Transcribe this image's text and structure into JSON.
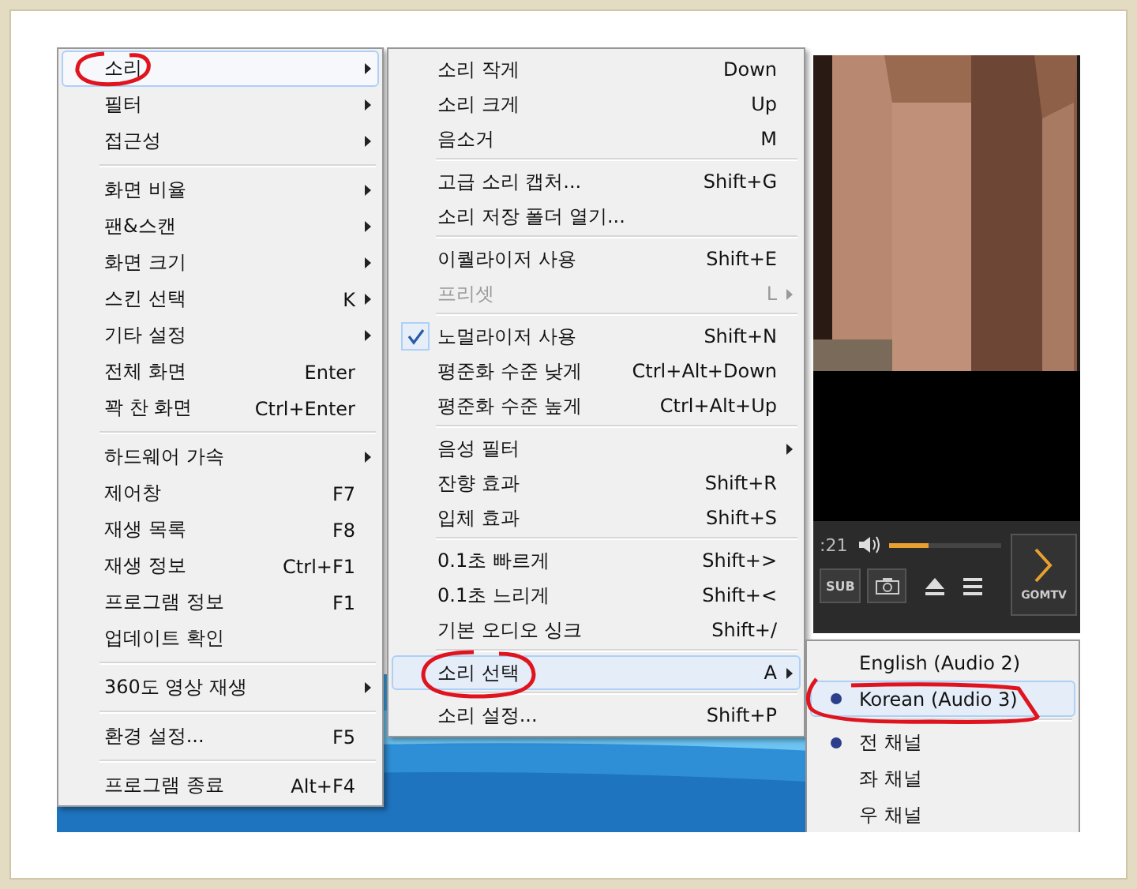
{
  "main_menu": {
    "items": [
      {
        "kind": "item",
        "label": "소리",
        "submenu": true,
        "selected": true
      },
      {
        "kind": "item",
        "label": "필터",
        "submenu": true,
        "selected": false
      },
      {
        "kind": "item",
        "label": "접근성",
        "submenu": true,
        "selected": false
      },
      {
        "kind": "separator"
      },
      {
        "kind": "item",
        "label": "화면 비율",
        "submenu": true,
        "selected": false
      },
      {
        "kind": "item",
        "label": "팬&스캔",
        "submenu": true,
        "selected": false
      },
      {
        "kind": "item",
        "label": "화면 크기",
        "submenu": true,
        "selected": false
      },
      {
        "kind": "item",
        "label": "스킨 선택",
        "shortcut": "K",
        "submenu": true,
        "selected": false
      },
      {
        "kind": "item",
        "label": "기타 설정",
        "submenu": true,
        "selected": false
      },
      {
        "kind": "item",
        "label": "전체 화면",
        "shortcut": "Enter",
        "submenu": false,
        "selected": false
      },
      {
        "kind": "item",
        "label": "꽉 찬 화면",
        "shortcut": "Ctrl+Enter",
        "submenu": false,
        "selected": false
      },
      {
        "kind": "separator"
      },
      {
        "kind": "item",
        "label": "하드웨어 가속",
        "submenu": true,
        "selected": false
      },
      {
        "kind": "item",
        "label": "제어창",
        "shortcut": "F7",
        "submenu": false,
        "selected": false
      },
      {
        "kind": "item",
        "label": "재생 목록",
        "shortcut": "F8",
        "submenu": false,
        "selected": false
      },
      {
        "kind": "item",
        "label": "재생 정보",
        "shortcut": "Ctrl+F1",
        "submenu": false,
        "selected": false
      },
      {
        "kind": "item",
        "label": "프로그램 정보",
        "shortcut": "F1",
        "submenu": false,
        "selected": false
      },
      {
        "kind": "item",
        "label": "업데이트 확인",
        "submenu": false,
        "selected": false
      },
      {
        "kind": "separator"
      },
      {
        "kind": "item",
        "label": "360도 영상 재생",
        "submenu": true,
        "selected": false
      },
      {
        "kind": "separator"
      },
      {
        "kind": "item",
        "label": "환경 설정...",
        "shortcut": "F5",
        "submenu": false,
        "selected": false
      },
      {
        "kind": "separator"
      },
      {
        "kind": "item",
        "label": "프로그램 종료",
        "shortcut": "Alt+F4",
        "submenu": false,
        "selected": false
      }
    ]
  },
  "sound_menu": {
    "items": [
      {
        "kind": "item",
        "label": "소리 작게",
        "shortcut": "Down",
        "submenu": false,
        "checked": false,
        "disabled": false,
        "selected": false
      },
      {
        "kind": "item",
        "label": "소리 크게",
        "shortcut": "Up",
        "submenu": false,
        "checked": false,
        "disabled": false,
        "selected": false
      },
      {
        "kind": "item",
        "label": "음소거",
        "shortcut": "M",
        "submenu": false,
        "checked": false,
        "disabled": false,
        "selected": false
      },
      {
        "kind": "separator"
      },
      {
        "kind": "item",
        "label": "고급 소리 캡처...",
        "shortcut": "Shift+G",
        "submenu": false,
        "checked": false,
        "disabled": false,
        "selected": false
      },
      {
        "kind": "item",
        "label": "소리 저장 폴더 열기...",
        "submenu": false,
        "checked": false,
        "disabled": false,
        "selected": false
      },
      {
        "kind": "separator"
      },
      {
        "kind": "item",
        "label": "이퀄라이저 사용",
        "shortcut": "Shift+E",
        "submenu": false,
        "checked": false,
        "disabled": false,
        "selected": false
      },
      {
        "kind": "item",
        "label": "프리셋",
        "shortcut": "L",
        "submenu": true,
        "checked": false,
        "disabled": true,
        "selected": false
      },
      {
        "kind": "separator"
      },
      {
        "kind": "item",
        "label": "노멀라이저 사용",
        "shortcut": "Shift+N",
        "submenu": false,
        "checked": true,
        "disabled": false,
        "selected": false
      },
      {
        "kind": "item",
        "label": "평준화 수준 낮게",
        "shortcut": "Ctrl+Alt+Down",
        "submenu": false,
        "checked": false,
        "disabled": false,
        "selected": false
      },
      {
        "kind": "item",
        "label": "평준화 수준 높게",
        "shortcut": "Ctrl+Alt+Up",
        "submenu": false,
        "checked": false,
        "disabled": false,
        "selected": false
      },
      {
        "kind": "separator"
      },
      {
        "kind": "item",
        "label": "음성 필터",
        "submenu": true,
        "checked": false,
        "disabled": false,
        "selected": false
      },
      {
        "kind": "item",
        "label": "잔향 효과",
        "shortcut": "Shift+R",
        "submenu": false,
        "checked": false,
        "disabled": false,
        "selected": false
      },
      {
        "kind": "item",
        "label": "입체 효과",
        "shortcut": "Shift+S",
        "submenu": false,
        "checked": false,
        "disabled": false,
        "selected": false
      },
      {
        "kind": "separator"
      },
      {
        "kind": "item",
        "label": "0.1초 빠르게",
        "shortcut": "Shift+>",
        "submenu": false,
        "checked": false,
        "disabled": false,
        "selected": false
      },
      {
        "kind": "item",
        "label": "0.1초 느리게",
        "shortcut": "Shift+<",
        "submenu": false,
        "checked": false,
        "disabled": false,
        "selected": false
      },
      {
        "kind": "item",
        "label": "기본 오디오 싱크",
        "shortcut": "Shift+/",
        "submenu": false,
        "checked": false,
        "disabled": false,
        "selected": false
      },
      {
        "kind": "separator"
      },
      {
        "kind": "item",
        "label": "소리 선택",
        "shortcut": "A",
        "submenu": true,
        "checked": false,
        "disabled": false,
        "selected": true
      },
      {
        "kind": "separator"
      },
      {
        "kind": "item",
        "label": "소리 설정...",
        "shortcut": "Shift+P",
        "submenu": false,
        "checked": false,
        "disabled": false,
        "selected": false
      }
    ]
  },
  "audio_submenu": {
    "items": [
      {
        "kind": "item",
        "label": "English (Audio 2)",
        "checked": false,
        "selected": false
      },
      {
        "kind": "item",
        "label": "Korean (Audio 3)",
        "checked": true,
        "selected": true
      },
      {
        "kind": "separator"
      },
      {
        "kind": "item",
        "label": "전 채널",
        "checked": true,
        "selected": false
      },
      {
        "kind": "item",
        "label": "좌 채널",
        "checked": false,
        "selected": false
      },
      {
        "kind": "item",
        "label": "우 채널",
        "checked": false,
        "selected": false
      }
    ]
  },
  "player": {
    "time": ":21",
    "volume": {
      "level": 0.35
    },
    "buttons": [
      {
        "kind": "subtitle",
        "label": "SUB"
      },
      {
        "kind": "camera"
      },
      {
        "kind": "eject"
      },
      {
        "kind": "menu"
      }
    ],
    "brand_button": {
      "label": "GOMTV"
    }
  }
}
